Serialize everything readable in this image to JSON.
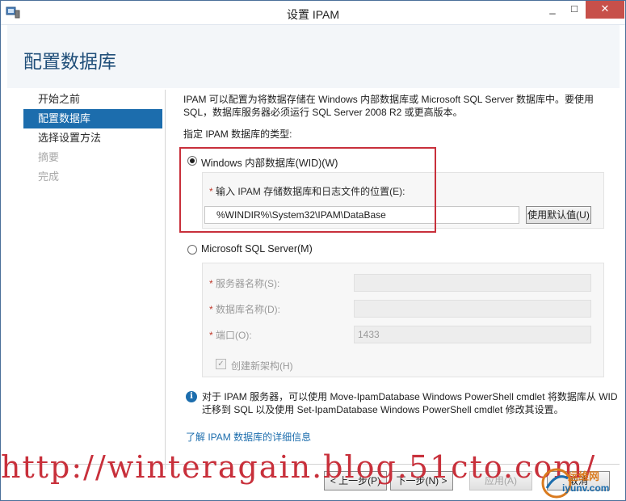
{
  "window": {
    "title": "设置 IPAM",
    "minimize": "_",
    "maximize": "□",
    "close": "✕"
  },
  "page": {
    "heading": "配置数据库"
  },
  "nav": {
    "items": [
      {
        "label": "开始之前",
        "state": "normal"
      },
      {
        "label": "配置数据库",
        "state": "active"
      },
      {
        "label": "选择设置方法",
        "state": "normal"
      },
      {
        "label": "摘要",
        "state": "disabled"
      },
      {
        "label": "完成",
        "state": "disabled"
      }
    ]
  },
  "content": {
    "description": "IPAM 可以配置为将数据存储在 Windows 内部数据库或 Microsoft SQL Server 数据库中。要使用 SQL，数据库服务器必须运行 SQL Server 2008 R2 或更高版本。",
    "prompt": "指定 IPAM 数据库的类型:",
    "wid_option": {
      "label": "Windows 内部数据库(WID)(W)",
      "selected": true,
      "location_label": "输入 IPAM 存储数据库和日志文件的位置(E):",
      "location_value": "%WINDIR%\\System32\\IPAM\\DataBase",
      "default_button": "使用默认值(U)"
    },
    "sql_option": {
      "label": "Microsoft SQL Server(M)",
      "selected": false,
      "server_label": "服务器名称(S):",
      "server_value": "",
      "db_label": "数据库名称(D):",
      "db_value": "",
      "port_label": "端口(O):",
      "port_value": "1433",
      "schema_label": "创建新架构(H)",
      "schema_checked": true
    },
    "required_mark": "*",
    "info_icon": "i",
    "info_text": "对于 IPAM 服务器，可以使用 Move-IpamDatabase Windows PowerShell cmdlet 将数据库从 WID 迁移到 SQL 以及使用 Set-IpamDatabase Windows PowerShell cmdlet 修改其设置。",
    "learn_more": "了解 IPAM 数据库的详细信息"
  },
  "footer": {
    "prev": "< 上一步(P)",
    "next": "下一步(N) >",
    "apply": "应用(A)",
    "cancel": "取消"
  },
  "overlay": {
    "watermark": "http://winteragain.blog.51cto.com/",
    "logo_line1": "运维网",
    "logo_line2": "iyunv.com"
  },
  "colors": {
    "accent": "#1c6dad",
    "heading": "#1f4e79",
    "annotation_red": "#c8303b",
    "close_button": "#c7504a"
  },
  "icons": {
    "app": "server-manager-icon",
    "info": "info-icon",
    "check": "checkmark-icon"
  }
}
